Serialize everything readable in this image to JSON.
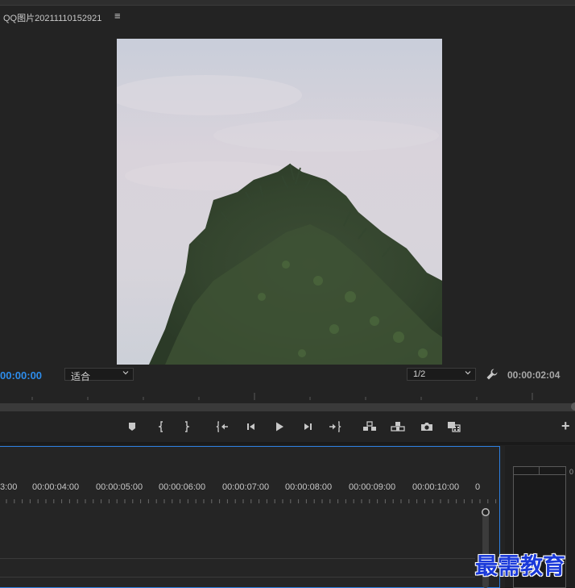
{
  "monitor": {
    "title": "QQ图片20211110152921",
    "menu_icon": "hamburger-icon",
    "timecode_current": "00:00:00",
    "zoom_value": "适合",
    "resolution_value": "1/2",
    "timecode_duration": "00:00:02:04"
  },
  "transport": {
    "buttons": [
      "add-marker-icon",
      "mark-in-icon",
      "mark-out-icon",
      "go-to-in-icon",
      "step-back-icon",
      "play-icon",
      "step-forward-icon",
      "go-to-out-icon",
      "insert-icon",
      "overwrite-icon",
      "export-frame-icon",
      "button-editor-icon"
    ],
    "add_label": "+"
  },
  "timeline": {
    "ruler_labels": [
      "3:00",
      "00:00:04:00",
      "00:00:05:00",
      "00:00:06:00",
      "00:00:07:00",
      "00:00:08:00",
      "00:00:09:00",
      "00:00:10:00",
      "0"
    ]
  },
  "meter": {
    "scale_label": "0"
  },
  "watermark": {
    "text": "最需教育"
  },
  "colors": {
    "accent_blue": "#2d8ceb",
    "panel_bg": "#232323",
    "focus_border": "#2d7fe0"
  }
}
